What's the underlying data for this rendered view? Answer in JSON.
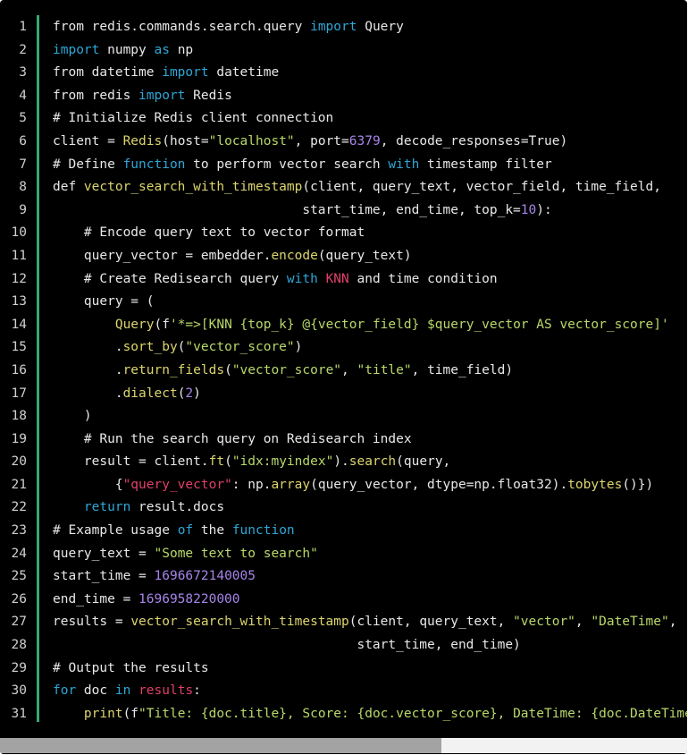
{
  "editor": {
    "line_numbers": [
      "1",
      "2",
      "3",
      "4",
      "5",
      "6",
      "7",
      "8",
      "9",
      "10",
      "11",
      "12",
      "13",
      "14",
      "15",
      "16",
      "17",
      "18",
      "19",
      "20",
      "21",
      "22",
      "23",
      "24",
      "25",
      "26",
      "27",
      "28",
      "29",
      "30",
      "31"
    ],
    "lines": [
      [
        [
          "from redis.commands.search.query ",
          "t"
        ],
        [
          "import",
          "kw"
        ],
        [
          " Query",
          "t"
        ]
      ],
      [
        [
          "import",
          "kw"
        ],
        [
          " numpy ",
          "t"
        ],
        [
          "as",
          "kw"
        ],
        [
          " np",
          "t"
        ]
      ],
      [
        [
          "from datetime ",
          "t"
        ],
        [
          "import",
          "kw"
        ],
        [
          " datetime",
          "t"
        ]
      ],
      [
        [
          "from redis ",
          "t"
        ],
        [
          "import",
          "kw"
        ],
        [
          " Redis",
          "t"
        ]
      ],
      [
        [
          "# Initialize Redis client connection",
          "cm"
        ]
      ],
      [
        [
          "client = ",
          "t"
        ],
        [
          "Redis",
          "fn"
        ],
        [
          "(host=",
          "t"
        ],
        [
          "\"localhost\"",
          "str"
        ],
        [
          ", port=",
          "t"
        ],
        [
          "6379",
          "num"
        ],
        [
          ", decode_responses=True)",
          "t"
        ]
      ],
      [
        [
          "# Define ",
          "cm"
        ],
        [
          "function",
          "kw"
        ],
        [
          " to perform vector search ",
          "cm"
        ],
        [
          "with",
          "kw"
        ],
        [
          " timestamp filter",
          "cm"
        ]
      ],
      [
        [
          "def ",
          "t"
        ],
        [
          "vector_search_with_timestamp",
          "fn"
        ],
        [
          "(client, query_text, vector_field, time_field,",
          "t"
        ]
      ],
      [
        [
          "                                start_time, end_time, top_k=",
          "t"
        ],
        [
          "10",
          "num"
        ],
        [
          "):",
          "t"
        ]
      ],
      [
        [
          "    # Encode query text to vector format",
          "cm"
        ]
      ],
      [
        [
          "    query_vector = embedder.",
          "t"
        ],
        [
          "encode",
          "fn"
        ],
        [
          "(query_text)",
          "t"
        ]
      ],
      [
        [
          "    # Create Redisearch query ",
          "cm"
        ],
        [
          "with",
          "kw"
        ],
        [
          " ",
          "cm"
        ],
        [
          "KNN",
          "red"
        ],
        [
          " and time condition",
          "cm"
        ]
      ],
      [
        [
          "    query = (",
          "t"
        ]
      ],
      [
        [
          "        ",
          "t"
        ],
        [
          "Query",
          "fn"
        ],
        [
          "(f",
          "t"
        ],
        [
          "'*=>[KNN {top_k} @{vector_field} $query_vector AS vector_score]'",
          "str"
        ]
      ],
      [
        [
          "        .",
          "t"
        ],
        [
          "sort_by",
          "fn"
        ],
        [
          "(",
          "t"
        ],
        [
          "\"vector_score\"",
          "str"
        ],
        [
          ")",
          "t"
        ]
      ],
      [
        [
          "        .",
          "t"
        ],
        [
          "return_fields",
          "fn"
        ],
        [
          "(",
          "t"
        ],
        [
          "\"vector_score\"",
          "str"
        ],
        [
          ", ",
          "t"
        ],
        [
          "\"title\"",
          "str"
        ],
        [
          ", time_field)",
          "t"
        ]
      ],
      [
        [
          "        .",
          "t"
        ],
        [
          "dialect",
          "fn"
        ],
        [
          "(",
          "t"
        ],
        [
          "2",
          "num"
        ],
        [
          ")",
          "t"
        ]
      ],
      [
        [
          "    )",
          "t"
        ]
      ],
      [
        [
          "    # Run the search query on Redisearch index",
          "cm"
        ]
      ],
      [
        [
          "    result = client.",
          "t"
        ],
        [
          "ft",
          "fn"
        ],
        [
          "(",
          "t"
        ],
        [
          "\"idx:myindex\"",
          "str"
        ],
        [
          ").",
          "t"
        ],
        [
          "search",
          "fn"
        ],
        [
          "(query,",
          "t"
        ]
      ],
      [
        [
          "        {",
          "t"
        ],
        [
          "\"query_vector\"",
          "red"
        ],
        [
          ": np.",
          "t"
        ],
        [
          "array",
          "fn"
        ],
        [
          "(query_vector, dtype=np.float32).",
          "t"
        ],
        [
          "tobytes",
          "fn"
        ],
        [
          "()})",
          "t"
        ]
      ],
      [
        [
          "    ",
          "t"
        ],
        [
          "return",
          "kw"
        ],
        [
          " result.docs",
          "t"
        ]
      ],
      [
        [
          "# Example usage ",
          "cm"
        ],
        [
          "of",
          "kw"
        ],
        [
          " the ",
          "cm"
        ],
        [
          "function",
          "kw"
        ]
      ],
      [
        [
          "query_text = ",
          "t"
        ],
        [
          "\"Some text to search\"",
          "str"
        ]
      ],
      [
        [
          "start_time = ",
          "t"
        ],
        [
          "1696672140005",
          "num"
        ]
      ],
      [
        [
          "end_time = ",
          "t"
        ],
        [
          "1696958220000",
          "num"
        ]
      ],
      [
        [
          "results = ",
          "t"
        ],
        [
          "vector_search_with_timestamp",
          "fn"
        ],
        [
          "(client, query_text, ",
          "t"
        ],
        [
          "\"vector\"",
          "str"
        ],
        [
          ", ",
          "t"
        ],
        [
          "\"DateTime\"",
          "str"
        ],
        [
          ",",
          "t"
        ]
      ],
      [
        [
          "                                       start_time, end_time)",
          "t"
        ]
      ],
      [
        [
          "# Output the results",
          "cm"
        ]
      ],
      [
        [
          "for",
          "kw"
        ],
        [
          " doc ",
          "t"
        ],
        [
          "in",
          "kw"
        ],
        [
          " ",
          "t"
        ],
        [
          "results",
          "red"
        ],
        [
          ":",
          "t"
        ]
      ],
      [
        [
          "    ",
          "t"
        ],
        [
          "print",
          "fn"
        ],
        [
          "(f",
          "t"
        ],
        [
          "\"Title: {doc.title}, Score: {doc.vector_score}, DateTime: {doc.DateTime}\"",
          "str"
        ],
        [
          ")",
          "t"
        ]
      ]
    ]
  },
  "scrollbar": {
    "thumb_fraction": 0.643
  }
}
